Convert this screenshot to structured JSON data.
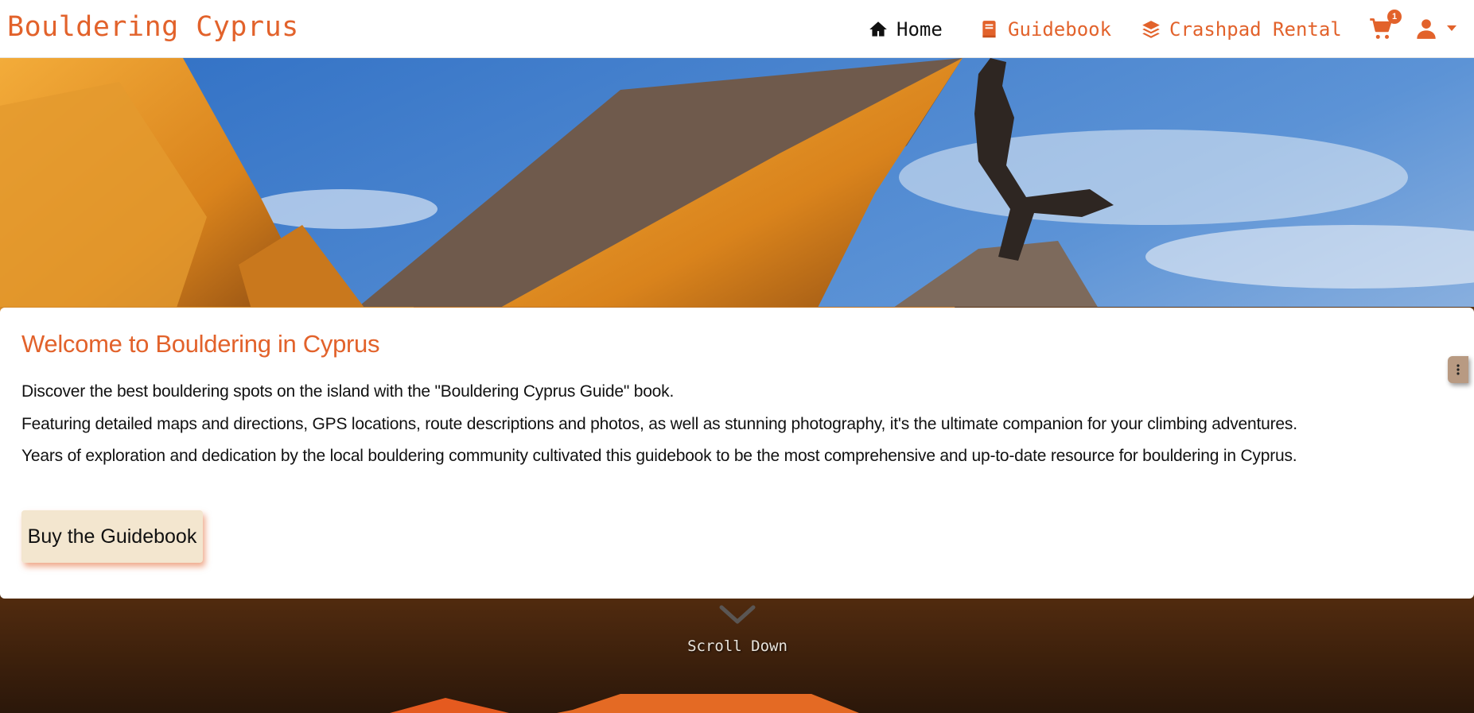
{
  "brand": {
    "name": "Bouldering Cyprus"
  },
  "nav": {
    "items": [
      {
        "label": "Home",
        "icon": "home-icon",
        "color": "#111111"
      },
      {
        "label": "Guidebook",
        "icon": "book-icon",
        "color": "#e2622b"
      },
      {
        "label": "Crashpad Rental",
        "icon": "layers-icon",
        "color": "#e2622b"
      }
    ],
    "cart": {
      "icon": "cart-icon",
      "count": "1"
    },
    "user": {
      "icon": "user-icon"
    }
  },
  "colors": {
    "accent": "#e2622b",
    "button_bg": "#f3e6cf"
  },
  "welcome": {
    "title": "Welcome to Bouldering in Cyprus",
    "paragraphs": [
      "Discover the best bouldering spots on the island with the \"Bouldering Cyprus Guide\" book.",
      "Featuring detailed maps and directions, GPS locations, route descriptions and photos, as well as stunning photography, it's the ultimate companion for your climbing adventures.",
      "Years of exploration and dedication by the local bouldering community cultivated this guidebook to be the most comprehensive and up-to-date resource for bouldering in Cyprus."
    ],
    "cta": "Buy the Guidebook"
  },
  "scroll": {
    "label": "Scroll Down"
  }
}
